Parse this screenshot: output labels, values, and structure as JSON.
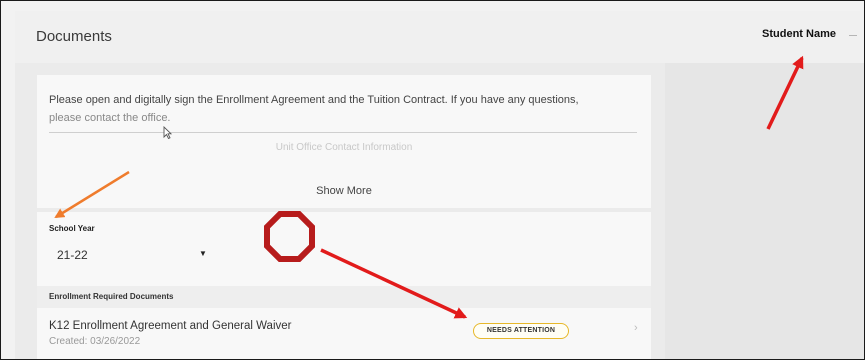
{
  "header": {
    "title": "Documents",
    "student_name": "Student Name"
  },
  "info": {
    "message_line1": "Please open and digitally sign the Enrollment Agreement and the Tuition Contract. If you have any questions,",
    "message_line2": "please contact the office.",
    "contact_link": "Unit Office Contact Information",
    "show_more": "Show More"
  },
  "school_year": {
    "label": "School Year",
    "value": "21-22",
    "caret": "▼"
  },
  "required_documents": {
    "header": "Enrollment Required Documents",
    "items": [
      {
        "name": "K12 Enrollment Agreement and General Waiver",
        "created": "Created: 03/26/2022",
        "status": "NEEDS ATTENTION",
        "chevron": "›"
      }
    ]
  },
  "annotations": {
    "red": "#e21b1b",
    "orange": "#ef7c2d",
    "stop_sign_color": "#b71c1c"
  }
}
